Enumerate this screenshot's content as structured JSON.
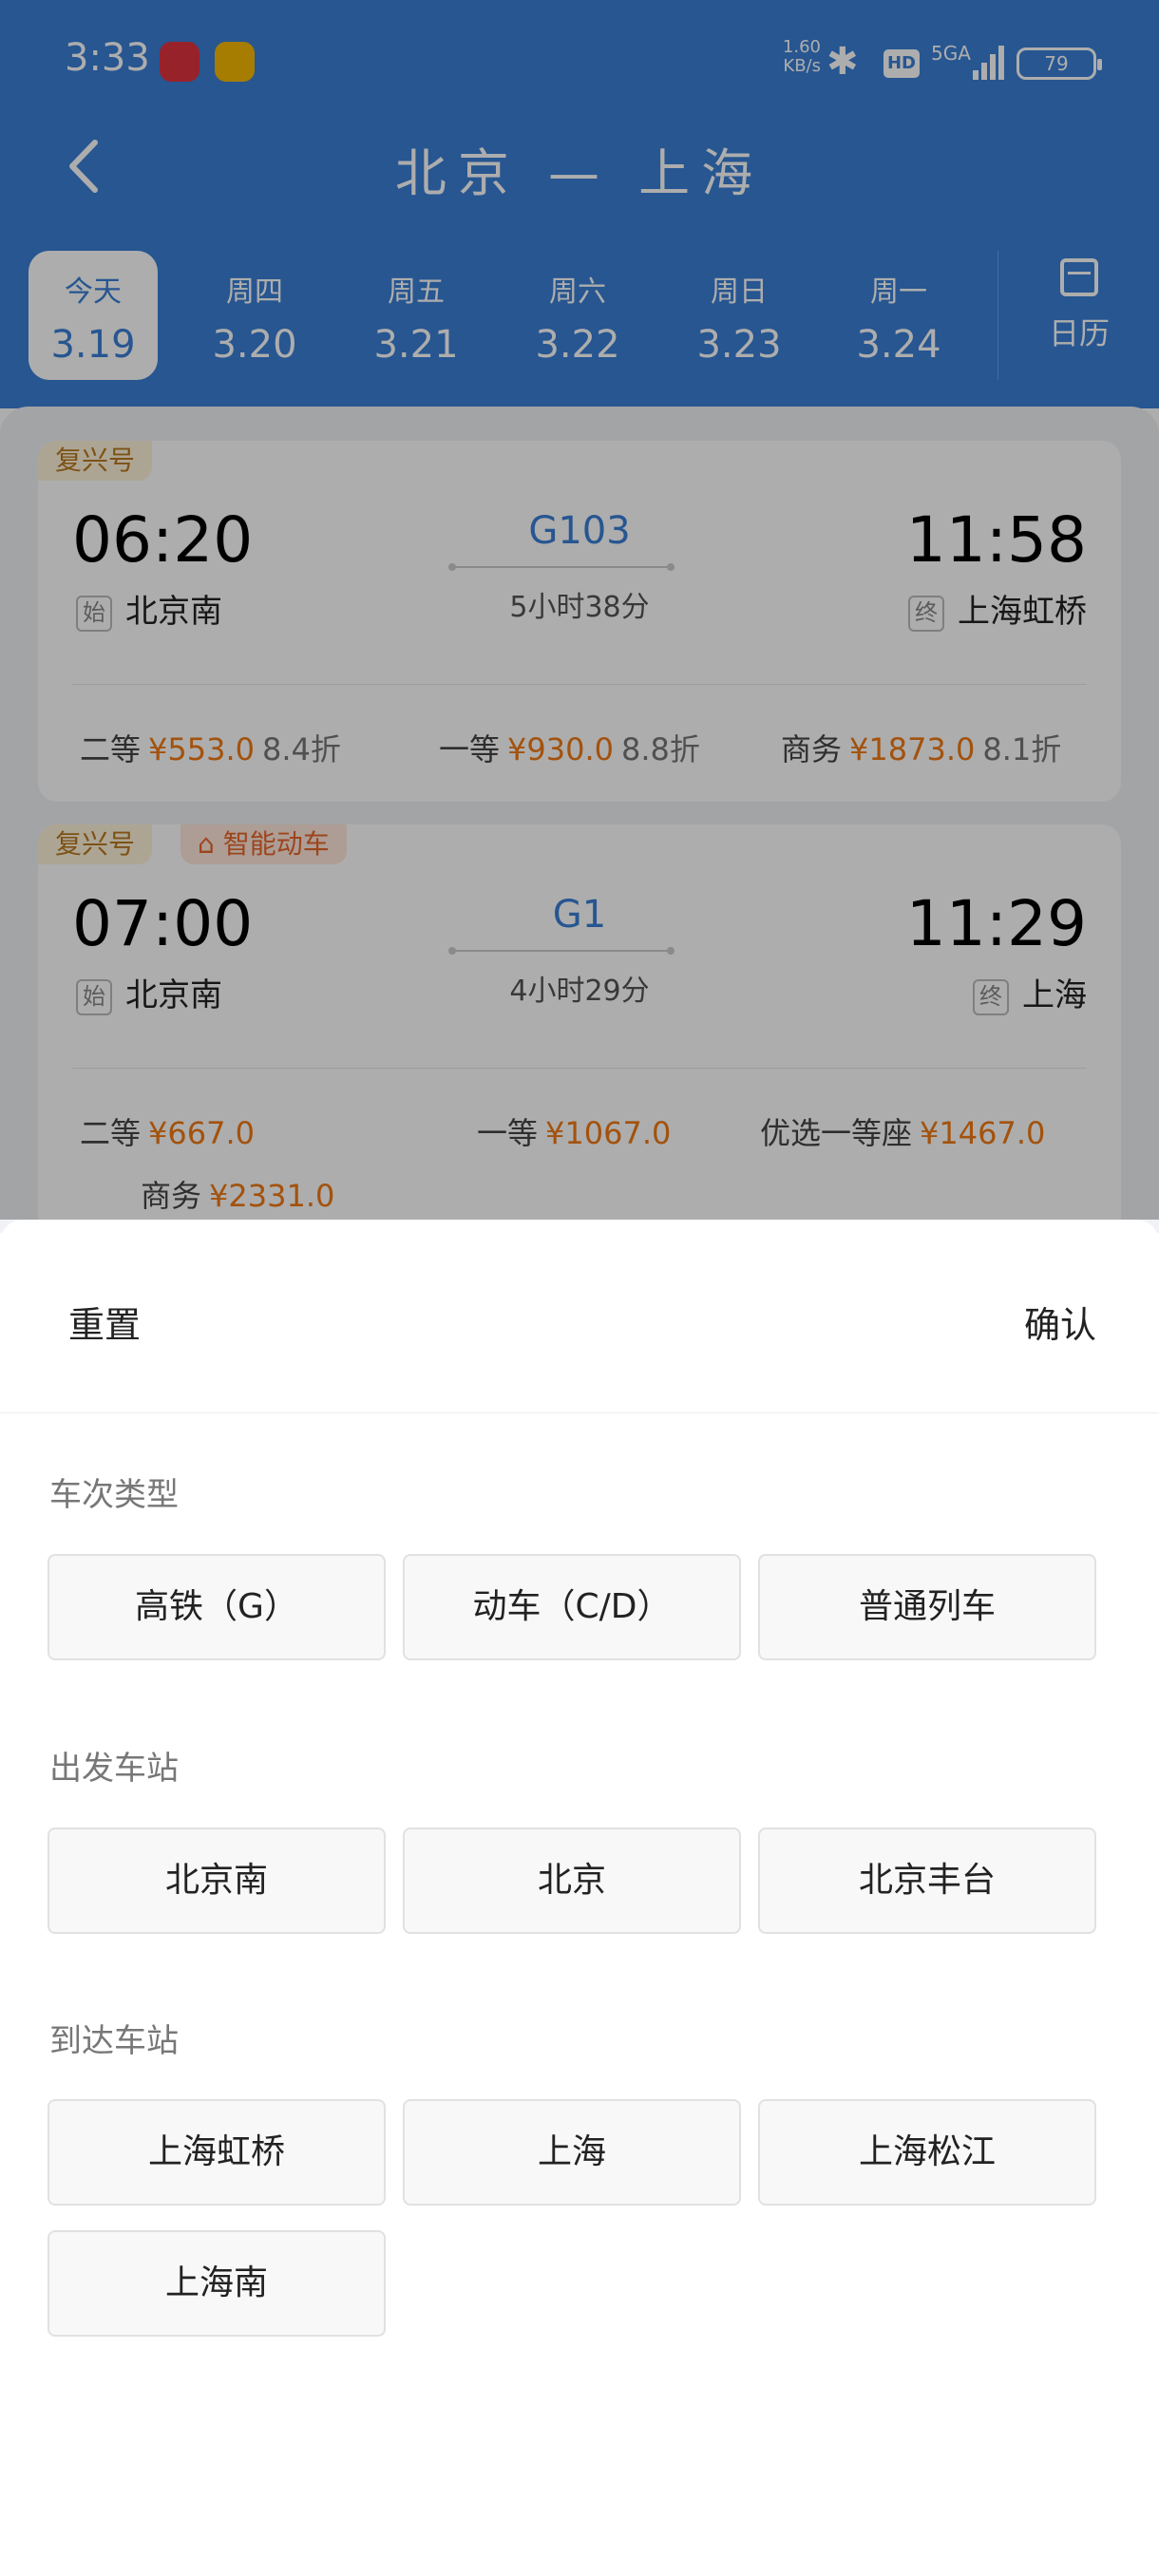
{
  "status_bar": {
    "time": "3:33",
    "net_speed_value": "1.60",
    "net_speed_unit": "KB/s",
    "hd": "HD",
    "network": "5GA",
    "battery": "79"
  },
  "header": {
    "back_icon": "chevron-left-icon",
    "title": "北京 — 上海"
  },
  "date_tabs": [
    {
      "weekday": "今天",
      "date": "3.19",
      "active": true
    },
    {
      "weekday": "周四",
      "date": "3.20"
    },
    {
      "weekday": "周五",
      "date": "3.21"
    },
    {
      "weekday": "周六",
      "date": "3.22"
    },
    {
      "weekday": "周日",
      "date": "3.23"
    },
    {
      "weekday": "周一",
      "date": "3.24"
    }
  ],
  "calendar": {
    "icon": "calendar-icon",
    "label": "日历"
  },
  "trains": [
    {
      "brand": "复兴号",
      "dep_time": "06:20",
      "arr_time": "11:58",
      "train_no": "G103",
      "duration": "5小时38分",
      "from_badge": "始",
      "from": "北京南",
      "to_badge": "终",
      "to": "上海虹桥",
      "prices": [
        {
          "cls": "二等",
          "amt": "¥553.0",
          "disc": "8.4折"
        },
        {
          "cls": "一等",
          "amt": "¥930.0",
          "disc": "8.8折"
        },
        {
          "cls": "商务",
          "amt": "¥1873.0",
          "disc": "8.1折"
        }
      ]
    },
    {
      "brand": "复兴号",
      "smart_tag": "智能动车",
      "dep_time": "07:00",
      "arr_time": "11:29",
      "train_no": "G1",
      "duration": "4小时29分",
      "from_badge": "始",
      "from": "北京南",
      "to_badge": "终",
      "to": "上海",
      "prices": [
        {
          "cls": "二等",
          "amt": "¥667.0"
        },
        {
          "cls": "一等",
          "amt": "¥1067.0"
        },
        {
          "cls": "优选一等座",
          "amt": "¥1467.0"
        },
        {
          "cls": "商务",
          "amt": "¥2331.0"
        }
      ]
    }
  ],
  "sheet": {
    "reset": "重置",
    "confirm": "确认",
    "sections": [
      {
        "title": "车次类型",
        "options": [
          "高铁（G）",
          "动车（C/D）",
          "普通列车"
        ]
      },
      {
        "title": "出发车站",
        "options": [
          "北京南",
          "北京",
          "北京丰台"
        ]
      },
      {
        "title": "到达车站",
        "options": [
          "上海虹桥",
          "上海",
          "上海松江",
          "上海南"
        ]
      }
    ]
  },
  "colors": {
    "primary": "#3a7fd6",
    "price": "#f07a14",
    "brand_tag": "#b97a20",
    "smart_tag": "#e8662a"
  }
}
